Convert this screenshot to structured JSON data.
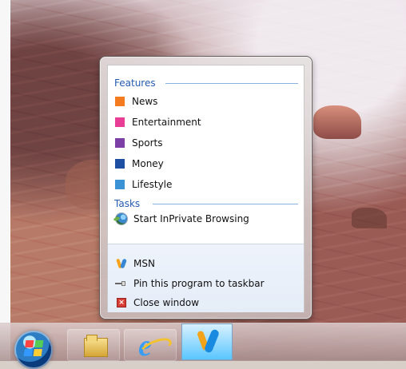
{
  "jump_list": {
    "features": {
      "title": "Features",
      "items": [
        {
          "label": "News",
          "color": "#f47b20"
        },
        {
          "label": "Entertainment",
          "color": "#e83e96"
        },
        {
          "label": "Sports",
          "color": "#7b3fa5"
        },
        {
          "label": "Money",
          "color": "#1f4fa3"
        },
        {
          "label": "Lifestyle",
          "color": "#3b93d6"
        }
      ]
    },
    "tasks": {
      "title": "Tasks",
      "items": [
        {
          "label": "Start InPrivate Browsing",
          "icon": "inprivate-browsing-icon"
        }
      ]
    },
    "program": {
      "items": [
        {
          "label": "MSN",
          "icon": "msn-icon"
        },
        {
          "label": "Pin this program to taskbar",
          "icon": "pin-icon"
        },
        {
          "label": "Close window",
          "icon": "close-icon"
        }
      ]
    }
  },
  "taskbar": {
    "items": [
      {
        "icon": "start-orb-icon"
      },
      {
        "icon": "folder-icon"
      },
      {
        "icon": "internet-explorer-icon"
      },
      {
        "icon": "msn-icon"
      }
    ]
  }
}
